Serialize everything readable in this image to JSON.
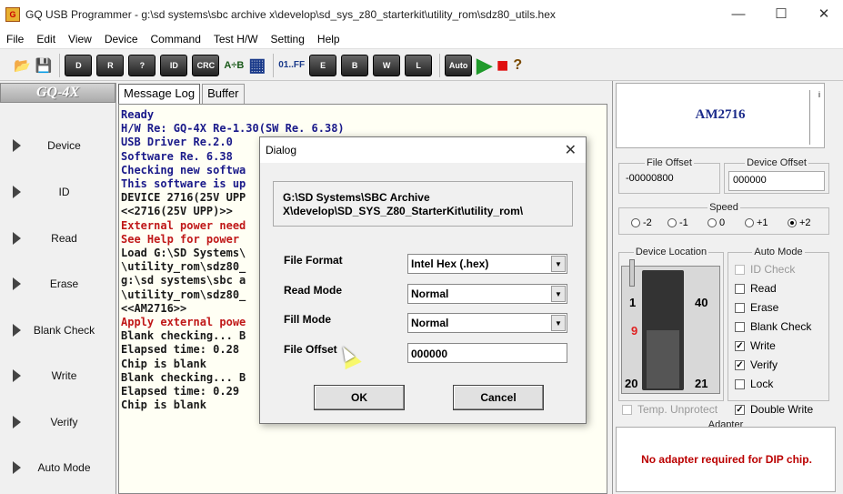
{
  "window": {
    "title": "GQ USB Programmer - g:\\sd systems\\sbc archive x\\develop\\sd_sys_z80_starterkit\\utility_rom\\sdz80_utils.hex",
    "minimize": "—",
    "maximize": "☐",
    "close": "✕"
  },
  "menu": [
    "File",
    "Edit",
    "View",
    "Device",
    "Command",
    "Test H/W",
    "Setting",
    "Help"
  ],
  "toolbar": {
    "buttons": [
      {
        "name": "open-icon",
        "glyph": "📂"
      },
      {
        "name": "save-icon",
        "glyph": "💾"
      },
      {
        "name": "device-chip-icon",
        "glyph": "D"
      },
      {
        "name": "read-chip-icon",
        "glyph": "R"
      },
      {
        "name": "verify-chip-icon",
        "glyph": "?"
      },
      {
        "name": "id-chip-icon",
        "glyph": "ID"
      },
      {
        "name": "crc-chip-icon",
        "glyph": "CRC"
      },
      {
        "name": "compare-ab-icon",
        "glyph": "A÷B"
      },
      {
        "name": "buffer-editor-icon",
        "glyph": "▦"
      },
      {
        "name": "fill-ff-icon",
        "glyph": "01..FF"
      },
      {
        "name": "erase-chip-icon",
        "glyph": "E"
      },
      {
        "name": "blank-check-chip-icon",
        "glyph": "B"
      },
      {
        "name": "write-chip-icon",
        "glyph": "W"
      },
      {
        "name": "lock-chip-icon",
        "glyph": "L"
      },
      {
        "name": "auto-chip-icon",
        "glyph": "Auto"
      },
      {
        "name": "run-icon",
        "glyph": "▶"
      },
      {
        "name": "stop-icon",
        "glyph": "■"
      },
      {
        "name": "help-icon",
        "glyph": "?"
      }
    ],
    "colors": {
      "run": "#1f9a2a",
      "stop": "#e01010"
    }
  },
  "sidebar": {
    "logo": "GQ-4X",
    "items": [
      "Device",
      "ID",
      "Read",
      "Erase",
      "Blank Check",
      "Write",
      "Verify",
      "Auto Mode"
    ]
  },
  "tabs": [
    "Message Log",
    "Buffer"
  ],
  "log": [
    {
      "t": "Ready",
      "c": "#1a1a8a"
    },
    {
      "t": "H/W Re: GQ-4X Re-1.30(SW Re. 6.38)",
      "c": "#1a1a8a"
    },
    {
      "t": "USB Driver Re.2.0",
      "c": "#1a1a8a"
    },
    {
      "t": "Software Re. 6.38",
      "c": "#1a1a8a"
    },
    {
      "t": "Checking new softwa",
      "c": "#1a1a8a"
    },
    {
      "t": "This software is up",
      "c": "#1a1a8a"
    },
    {
      "t": "DEVICE 2716(25V UPP",
      "c": "#1a1a1a"
    },
    {
      "t": "<<2716(25V UPP)>>",
      "c": "#1a1a1a"
    },
    {
      "t": "External power need",
      "c": "#c01818"
    },
    {
      "t": "See Help for power",
      "c": "#c01818"
    },
    {
      "t": "Load G:\\SD Systems\\",
      "c": "#1a1a1a"
    },
    {
      "t": "\\utility_rom\\sdz80_",
      "c": "#1a1a1a"
    },
    {
      "t": "g:\\sd systems\\sbc a",
      "c": "#1a1a1a"
    },
    {
      "t": "\\utility_rom\\sdz80_",
      "c": "#1a1a1a"
    },
    {
      "t": "<<AM2716>>",
      "c": "#1a1a1a"
    },
    {
      "t": "Apply external powe",
      "c": "#c01818"
    },
    {
      "t": "Blank checking... B",
      "c": "#1a1a1a"
    },
    {
      "t": "Elapsed time: 0.28",
      "c": "#1a1a1a"
    },
    {
      "t": "Chip is blank",
      "c": "#1a1a1a"
    },
    {
      "t": "Blank checking... B",
      "c": "#1a1a1a"
    },
    {
      "t": "Elapsed time: 0.29",
      "c": "#1a1a1a"
    },
    {
      "t": "Chip is blank",
      "c": "#1a1a1a"
    }
  ],
  "right": {
    "chip_name": "AM2716",
    "scroll_glyph": "i",
    "file_offset": {
      "label": "File Offset",
      "value": "-00000800"
    },
    "device_offset": {
      "label": "Device Offset",
      "value": "000000"
    },
    "speed": {
      "label": "Speed",
      "options": [
        "-2",
        "-1",
        "0",
        "+1",
        "+2"
      ],
      "selected": "+2"
    },
    "device_location": {
      "label": "Device Location",
      "pin1": "1",
      "pin40": "40",
      "pin9": "9",
      "pin20": "20",
      "pin21": "21"
    },
    "auto_mode": {
      "label": "Auto Mode",
      "options": [
        {
          "label": "ID Check",
          "checked": false,
          "disabled": true
        },
        {
          "label": "Read",
          "checked": false,
          "disabled": false
        },
        {
          "label": "Erase",
          "checked": false,
          "disabled": false
        },
        {
          "label": "Blank Check",
          "checked": false,
          "disabled": false
        },
        {
          "label": "Write",
          "checked": true,
          "disabled": false
        },
        {
          "label": "Verify",
          "checked": true,
          "disabled": false
        },
        {
          "label": "Lock",
          "checked": false,
          "disabled": false
        }
      ]
    },
    "temp_unprotect": {
      "label": "Temp. Unprotect",
      "checked": false
    },
    "double_write": {
      "label": "Double Write",
      "checked": true
    },
    "adapter": {
      "label": "Adapter",
      "message": "No adapter required for DIP chip."
    }
  },
  "dialog": {
    "title": "Dialog",
    "path_line1": "G:\\SD Systems\\SBC Archive",
    "path_line2": "X\\develop\\SD_SYS_Z80_StarterKit\\utility_rom\\",
    "file_format": {
      "label": "File Format",
      "value": "Intel Hex (.hex)"
    },
    "read_mode": {
      "label": "Read Mode",
      "value": "Normal"
    },
    "fill_mode": {
      "label": "Fill Mode",
      "value": "Normal"
    },
    "file_offset": {
      "label": "File Offset",
      "value": "000000"
    },
    "ok": "OK",
    "cancel": "Cancel"
  }
}
